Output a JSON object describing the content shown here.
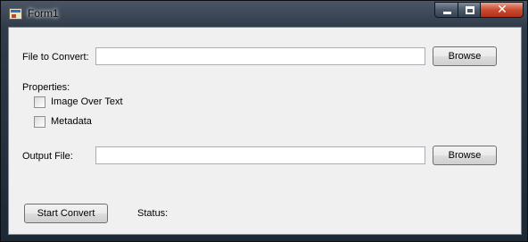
{
  "window": {
    "title": "Form1",
    "title_color": "#0b0b0b",
    "close_color": "#c94b2f"
  },
  "form": {
    "file_to_convert_label": "File to Convert:",
    "file_to_convert_value": "",
    "browse_input_label": "Browse",
    "properties_label": "Properties:",
    "options": [
      {
        "label": "Image Over Text",
        "checked": false
      },
      {
        "label": "Metadata",
        "checked": false
      }
    ],
    "output_file_label": "Output File:",
    "output_file_value": "",
    "browse_output_label": "Browse",
    "start_convert_label": "Start Convert",
    "status_label": "Status:",
    "status_value": ""
  }
}
